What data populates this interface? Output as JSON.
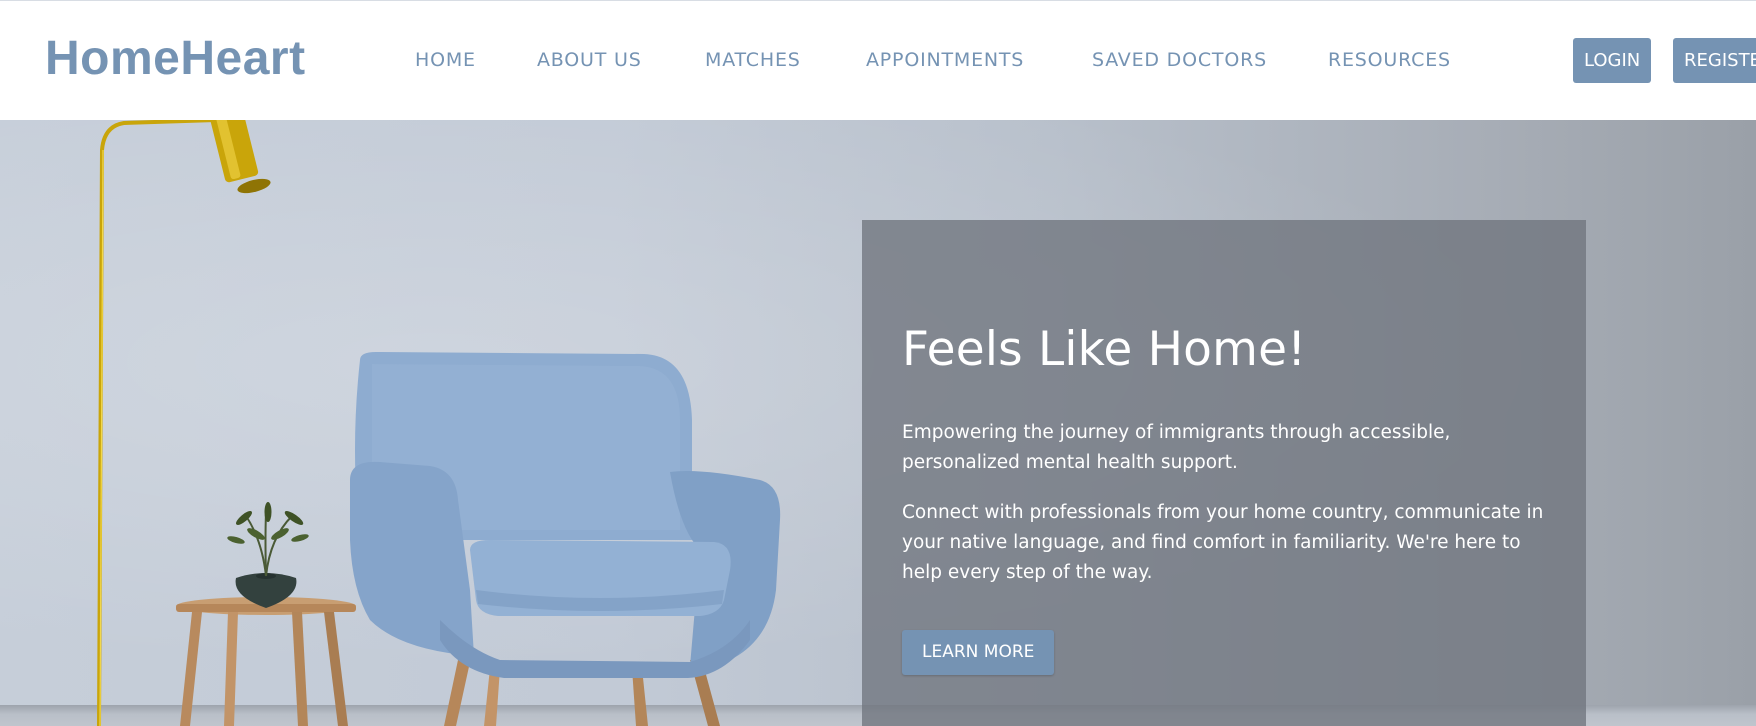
{
  "brand": {
    "name": "HomeHeart"
  },
  "nav": {
    "links": [
      "HOME",
      "ABOUT US",
      "MATCHES",
      "APPOINTMENTS",
      "SAVED DOCTORS",
      "RESOURCES"
    ],
    "login_label": "LOGIN",
    "register_label": "REGISTER"
  },
  "hero": {
    "title": "Feels Like Home!",
    "paragraph1": "Empowering the journey of immigrants through accessible, personalized mental health support.",
    "paragraph2": "Connect with professionals from your home country, communicate in your native language, and find comfort in familiarity. We're here to help every step of the way.",
    "cta_label": "LEARN MORE"
  },
  "colors": {
    "brand": "#7593b3",
    "button": "#7593b3",
    "panel_overlay": "#70757e",
    "lamp_gold": "#c9a50a",
    "chair_blue": "#8eacd0"
  },
  "icons": {
    "decor": [
      "floor-lamp",
      "side-table",
      "plant-vase",
      "armchair"
    ]
  }
}
